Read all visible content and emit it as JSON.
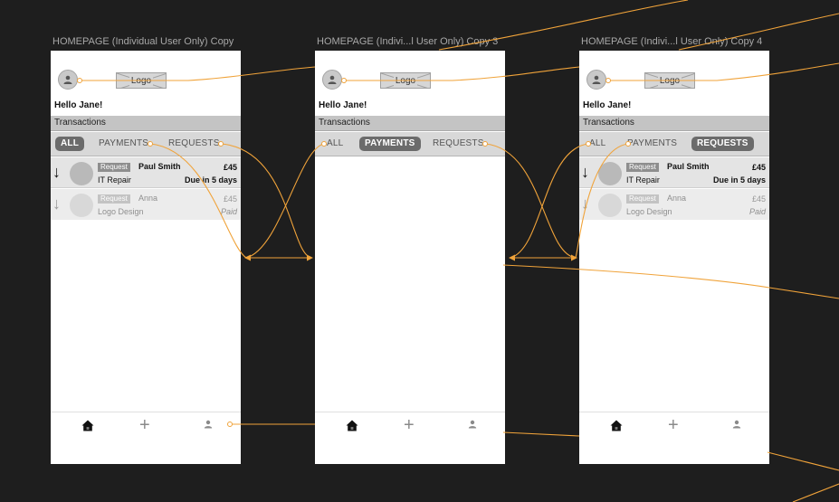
{
  "artboards": [
    {
      "title": "HOMEPAGE (Individual User Only)  Copy",
      "active_tab": 0
    },
    {
      "title": "HOMEPAGE (Indivi...l User Only)  Copy 3",
      "active_tab": 1
    },
    {
      "title": "HOMEPAGE (Indivi...l User Only)  Copy 4",
      "active_tab": 2
    }
  ],
  "screen": {
    "logo": "Logo",
    "greeting": "Hello Jane!",
    "section_title": "Transactions",
    "tabs": [
      "ALL",
      "PAYMENTS",
      "REQUESTS"
    ],
    "transactions": [
      {
        "badge": "Request",
        "name": "Paul Smith",
        "description": "IT Repair",
        "amount": "£45",
        "status": "Due in 5 days"
      },
      {
        "badge": "Request",
        "name": "Anna",
        "description": "Logo Design",
        "amount": "£45",
        "status": "Paid"
      }
    ],
    "nav_icons": [
      "home-icon",
      "plus-icon",
      "person-icon"
    ]
  },
  "colors": {
    "canvas": "#1e1e1e",
    "prototype_link": "#f0a33a",
    "active_tab": "#6b6b6b"
  }
}
